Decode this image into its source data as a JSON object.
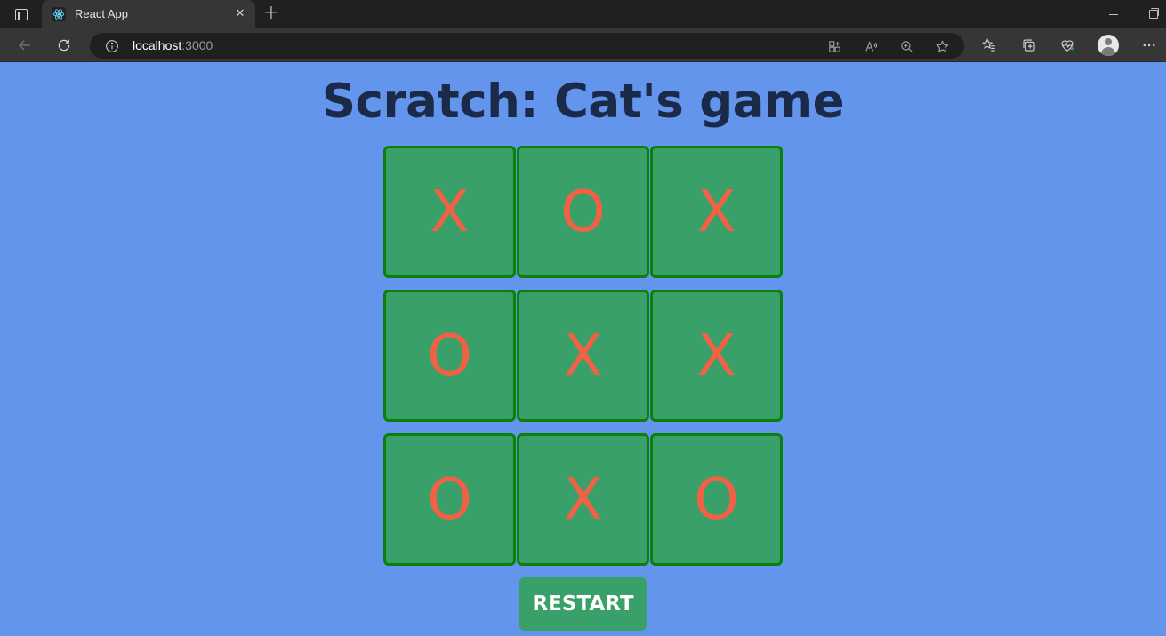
{
  "browser": {
    "tab_title": "React App",
    "tab_close_glyph": "✕",
    "new_tab_glyph": "+",
    "url_host": "localhost",
    "url_port": ":3000",
    "icons": [
      "tab-actions-icon",
      "react-favicon-icon",
      "close-icon",
      "new-tab-icon",
      "back-icon",
      "refresh-icon",
      "info-icon",
      "app-available-icon",
      "read-aloud-icon",
      "zoom-icon",
      "favorite-star-icon",
      "favorites-icon",
      "collections-icon",
      "browser-essentials-icon",
      "profile-icon",
      "more-icon",
      "minimize-icon",
      "restore-icon"
    ]
  },
  "game": {
    "title": "Scratch: Cat's game",
    "board": [
      [
        "X",
        "O",
        "X"
      ],
      [
        "O",
        "X",
        "X"
      ],
      [
        "O",
        "X",
        "O"
      ]
    ],
    "restart_label": "RESTART"
  },
  "colors": {
    "page_background": "#6495ed",
    "title_text": "#1b2a48",
    "cell_fill": "#3aa06a",
    "cell_border": "#0a7f0a",
    "mark_color": "#f26145",
    "button_fill": "#3aa06a",
    "button_text": "#ffffff"
  }
}
